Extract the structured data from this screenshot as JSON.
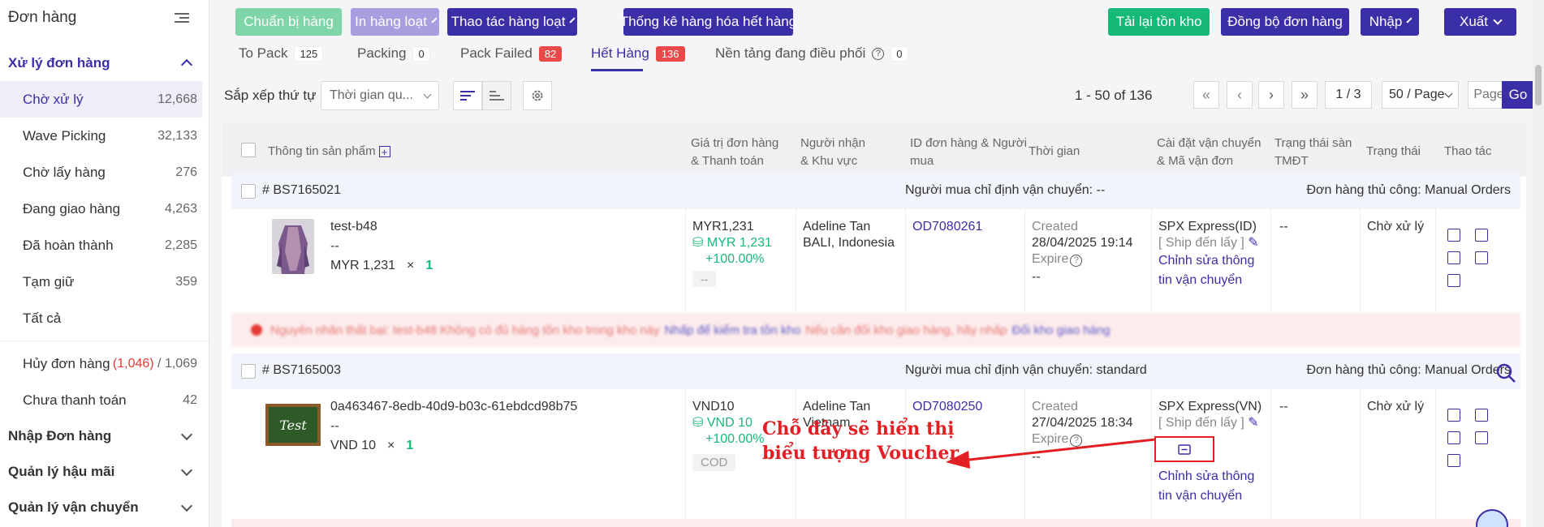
{
  "sidebar": {
    "header": "Đơn hàng",
    "section_orders": "Xử lý đơn hàng",
    "items": [
      {
        "label": "Chờ xử lý",
        "count": "12,668"
      },
      {
        "label": "Wave Picking",
        "count": "32,133"
      },
      {
        "label": "Chờ lấy hàng",
        "count": "276"
      },
      {
        "label": "Đang giao hàng",
        "count": "4,263"
      },
      {
        "label": "Đã hoàn thành",
        "count": "2,285"
      },
      {
        "label": "Tạm giữ",
        "count": "359"
      },
      {
        "label": "Tất cả",
        "count": ""
      }
    ],
    "cancel": {
      "label": "Hủy đơn hàng",
      "count_red": "(1,046)",
      "sep": " / ",
      "count": "1,069"
    },
    "unpaid": {
      "label": "Chưa thanh toán",
      "count": "42"
    },
    "sections": [
      "Nhập Đơn hàng",
      "Quản lý hậu mãi",
      "Quản lý vận chuyển"
    ]
  },
  "toolbar": {
    "prepare": "Chuẩn bị hàng",
    "bulk_print": "In hàng loạt",
    "bulk_action": "Thao tác hàng loạt",
    "stats_oos": "Thống kê hàng hóa hết hàng",
    "reload_stock": "Tải lại tồn kho",
    "sync_orders": "Đồng bộ đơn hàng",
    "import": "Nhập",
    "export": "Xuất"
  },
  "tabs": [
    {
      "label": "To Pack",
      "count": "125"
    },
    {
      "label": "Packing",
      "count": "0"
    },
    {
      "label": "Pack Failed",
      "count": "82"
    },
    {
      "label": "Hết Hàng",
      "count": "136"
    },
    {
      "label": "Nền tảng đang điều phối",
      "count": "0"
    }
  ],
  "sortbar": {
    "label": "Sắp xếp thứ tự",
    "sort_value": "Thời gian qu...",
    "range": "1 - 50 of 136",
    "page": "1 / 3",
    "per_page": "50 / Page",
    "page_placeholder": "Page",
    "go": "Go"
  },
  "columns": {
    "product": "Thông tin sản phẩm",
    "value_1": "Giá trị đơn hàng",
    "value_2": "& Thanh toán",
    "recipient_1": "Người nhận",
    "recipient_2": "& Khu vực",
    "orderid_1": "ID đơn hàng & Người",
    "orderid_2": "mua",
    "time": "Thời gian",
    "shipping_1": "Cài đặt vận chuyển",
    "shipping_2": "& Mã vận đơn",
    "platform_1": "Trạng thái sàn",
    "platform_2": "TMĐT",
    "status": "Trạng thái",
    "actions": "Thao tác"
  },
  "orders": [
    {
      "id": "# BS7165021",
      "carrier_note": "Người mua chỉ định vận chuyển: --",
      "manual": "Đơn hàng thủ công: Manual Orders",
      "product_name": "test-b48",
      "product_dash": "--",
      "product_price": "MYR 1,231",
      "times": "×",
      "qty": "1",
      "value": "MYR1,231",
      "paid": "MYR 1,231",
      "pct": "+100.00%",
      "pay_tag": "--",
      "recipient": "Adeline Tan",
      "region": "BALI, Indonesia",
      "order_link": "OD7080261",
      "created": "Created",
      "created_at": "28/04/2025 19:14",
      "expire": "Expire",
      "expire_val": "--",
      "carrier": "SPX Express(ID)",
      "ship_mode": "[ Ship đến lấy ]",
      "edit_1": "Chỉnh sửa thông",
      "edit_2": "tin vận chuyển",
      "platform_status": "--",
      "status": "Chờ xử lý"
    },
    {
      "id": "# BS7165003",
      "carrier_note": "Người mua chỉ định vận chuyển: standard",
      "manual": "Đơn hàng thủ công: Manual Orders",
      "product_name": "0a463467-8edb-40d9-b03c-61ebdcd98b75",
      "product_dash": "--",
      "product_price": "VND 10",
      "times": "×",
      "qty": "1",
      "thumb_text": "Test",
      "value": "VND10",
      "paid": "VND 10",
      "pct": "+100.00%",
      "pay_tag": "COD",
      "recipient": "Adeline Tan",
      "region": "Vietnam",
      "order_link": "OD7080250",
      "created": "Created",
      "created_at": "27/04/2025 18:34",
      "expire": "Expire",
      "expire_val": "--",
      "carrier": "SPX Express(VN)",
      "ship_mode": "[ Ship đến lấy ]",
      "edit_1": "Chỉnh sửa thông",
      "edit_2": "tin vận chuyển",
      "platform_status": "--",
      "status": "Chờ xử lý"
    }
  ],
  "error_row": {
    "text1": "Nguyên nhân thất bại: test-b48 Không có đủ hàng tồn kho trong kho này",
    "link1": "Nhấp để kiểm tra tồn kho",
    "text2": "Nếu cần đổi kho giao hàng, hãy nhấp",
    "link2": "Đổi kho giao hàng"
  },
  "annotation": {
    "line1": "Chỗ đây sẽ hiển thị",
    "line2": "biểu tượng Voucher"
  },
  "colors": {
    "primary": "#3b2fa8",
    "green": "#17b978",
    "danger": "#e53935",
    "annotation": "#e31e24"
  }
}
